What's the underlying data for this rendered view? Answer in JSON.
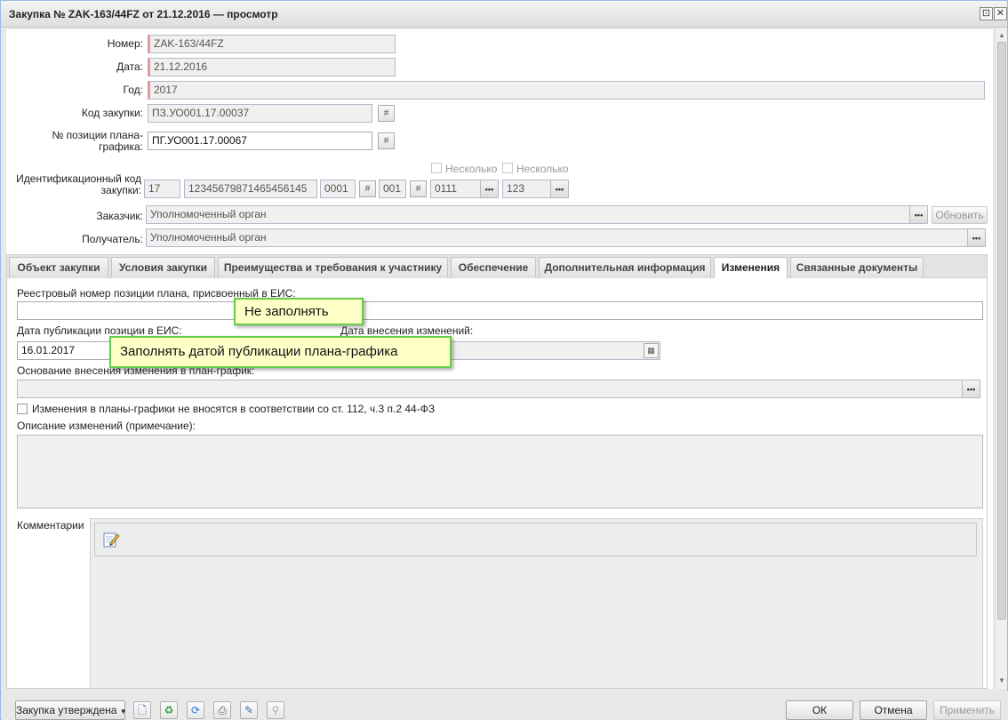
{
  "window": {
    "title": "Закупка № ZAK-163/44FZ от 21.12.2016 — просмотр",
    "restore_glyph": "⊡",
    "close_glyph": "✕"
  },
  "form": {
    "number_label": "Номер:",
    "number_value": "ZAK-163/44FZ",
    "date_label": "Дата:",
    "date_value": "21.12.2016",
    "year_label": "Год:",
    "year_value": "2017",
    "purchase_code_label": "Код закупки:",
    "purchase_code_value": "ПЗ.УО001.17.00037",
    "plan_position_label": "№ позиции плана-графика:",
    "plan_position_value": "ПГ.УО001.17.00067",
    "id_code_label": "Идентификационный код закупки:",
    "id_code_parts": [
      "17",
      "12345679871465456145",
      "0001",
      "001",
      "0111",
      "123"
    ],
    "several_label_1": "Несколько",
    "several_label_2": "Несколько",
    "customer_label": "Заказчик:",
    "customer_value": "Уполномоченный орган",
    "refresh_label": "Обновить",
    "recipient_label": "Получатель:",
    "recipient_value": "Уполномоченный орган"
  },
  "tabs": [
    {
      "label": "Объект закупки"
    },
    {
      "label": "Условия закупки"
    },
    {
      "label": "Преимущества и требования к участнику"
    },
    {
      "label": "Обеспечение"
    },
    {
      "label": "Дополнительная информация"
    },
    {
      "label": "Изменения",
      "active": true
    },
    {
      "label": "Связанные документы"
    }
  ],
  "changes_tab": {
    "registry_number_label": "Реестровый номер позиции плана, присвоенный в ЕИС:",
    "registry_number_value": "",
    "publication_date_label": "Дата публикации позиции в ЕИС:",
    "publication_date_value": "16.01.2017",
    "change_date_label": "Дата внесения изменений:",
    "change_date_value": "",
    "basis_label": "Основание внесения изменения в план-график:",
    "no_changes_checkbox_label": "Изменения в планы-графики не вносятся в соответствии со ст. 112, ч.3 п.2 44-ФЗ",
    "description_label": "Описание изменений (примечание):",
    "comments_label": "Комментарии"
  },
  "callouts": {
    "do_not_fill": "Не заполнять",
    "fill_with_date": "Заполнять датой публикации плана-графика"
  },
  "footer": {
    "status_button_label": "Закупка утверждена",
    "ok_label": "ОК",
    "cancel_label": "Отмена",
    "apply_label": "Применить"
  },
  "icons": {
    "calendar": "calendar-icon",
    "ellipsis": "ellipsis-icon",
    "edit_note": "edit-note-icon"
  },
  "colors": {
    "callout_border": "#66cc44",
    "callout_fill": "#ffffc8",
    "required_marker": "#e39a9a"
  }
}
